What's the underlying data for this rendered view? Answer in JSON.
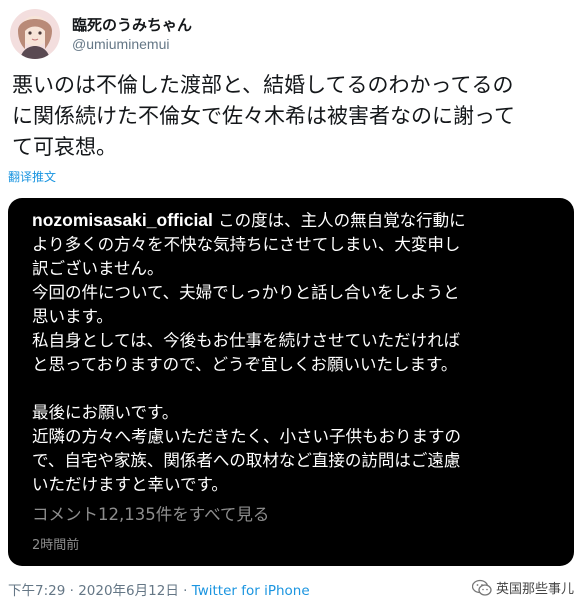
{
  "author": {
    "display_name": "臨死のうみちゃん",
    "handle": "@umiuminemui"
  },
  "tweet": {
    "text": "悪いのは不倫した渡部と、結婚してるのわかってるの\nに関係続けた不倫女で佐々木希は被害者なのに謝って\nて可哀想。",
    "translate_label": "翻译推文"
  },
  "embedded_post": {
    "username": "nozomisasaki_official",
    "lines": [
      "この度は、主人の無自覚な行動に",
      "より多くの方々を不快な気持ちにさせてしまい、大変申し",
      "訳ございません。",
      "今回の件について、夫婦でしっかりと話し合いをしようと",
      "思います。",
      "私自身としては、今後もお仕事を続けさせていただければ",
      "と思っておりますので、どうぞ宜しくお願いいたします。",
      "",
      "最後にお願いです。",
      "近隣の方々へ考慮いただきたく、小さい子供もおりますの",
      "で、自宅や家族、関係者への取材など直接の訪問はご遠慮",
      "いただけますと幸いです。"
    ],
    "comments_label": "コメント12,135件をすべて見る",
    "elapsed": "2時間前"
  },
  "meta": {
    "time": "下午7:29",
    "date": "2020年6月12日",
    "separator": " · ",
    "source": "Twitter for iPhone"
  },
  "watermark": {
    "text": "英国那些事儿",
    "icon": "wechat-icon"
  },
  "colors": {
    "link": "#1b95e0",
    "muted": "#657786",
    "card_bg": "#000000"
  }
}
